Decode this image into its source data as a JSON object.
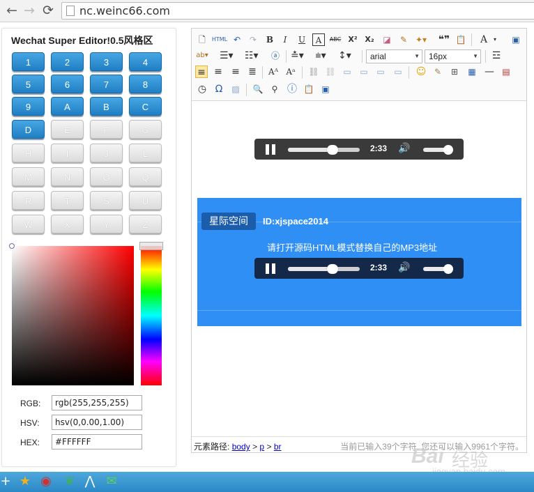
{
  "browser": {
    "back_icon": "←",
    "forward_icon": "→",
    "reload_icon": "⟳",
    "url": "nc.weinc66.com"
  },
  "left_panel": {
    "title": "Wechat Super Editor!0.5风格区",
    "style_buttons": [
      {
        "label": "1",
        "active": true
      },
      {
        "label": "2",
        "active": true
      },
      {
        "label": "3",
        "active": true
      },
      {
        "label": "4",
        "active": true
      },
      {
        "label": "5",
        "active": true
      },
      {
        "label": "6",
        "active": true
      },
      {
        "label": "7",
        "active": true
      },
      {
        "label": "8",
        "active": true
      },
      {
        "label": "9",
        "active": true
      },
      {
        "label": "A",
        "active": true
      },
      {
        "label": "B",
        "active": true
      },
      {
        "label": "C",
        "active": true
      },
      {
        "label": "D",
        "active": true
      },
      {
        "label": "E",
        "active": false
      },
      {
        "label": "F",
        "active": false
      },
      {
        "label": "G",
        "active": false
      },
      {
        "label": "H",
        "active": false
      },
      {
        "label": "I",
        "active": false
      },
      {
        "label": "J",
        "active": false
      },
      {
        "label": "L",
        "active": false
      },
      {
        "label": "M",
        "active": false
      },
      {
        "label": "N",
        "active": false
      },
      {
        "label": "O",
        "active": false
      },
      {
        "label": "Q",
        "active": false
      },
      {
        "label": "R",
        "active": false
      },
      {
        "label": "T",
        "active": false
      },
      {
        "label": "S",
        "active": false
      },
      {
        "label": "U",
        "active": false
      },
      {
        "label": "W",
        "active": false
      },
      {
        "label": "X",
        "active": false
      },
      {
        "label": "Y",
        "active": false
      },
      {
        "label": "Z",
        "active": false
      }
    ],
    "color_picker": {
      "base_hue_color": "#FF0000",
      "rgb_label": "RGB:",
      "rgb_value": "rgb(255,255,255)",
      "hsv_label": "HSV:",
      "hsv_value": "hsv(0,0.00,1.00)",
      "hex_label": "HEX:",
      "hex_value": "#FFFFFF"
    }
  },
  "toolbar": {
    "font_family": "arial",
    "font_size": "16px",
    "row1_icons": [
      "new-doc-icon",
      "html-icon",
      "undo-icon",
      "redo-icon",
      "bold-icon",
      "italic-icon",
      "underline-icon",
      "font-border-icon",
      "strikethrough-icon",
      "superscript-icon",
      "subscript-icon",
      "eraser-icon",
      "format-brush-icon",
      "auto-format-icon",
      "blockquote-icon",
      "paste-text-icon",
      "forecolor-icon",
      "fullscreen-icon"
    ],
    "row1_text": {
      "html": "HTML",
      "bold": "B",
      "italic": "I",
      "underline": "U",
      "fontborder": "A",
      "strike": "ABC",
      "sup": "X²",
      "sub": "X₂",
      "quote": "❝❞",
      "forecolor": "A"
    }
  },
  "editor": {
    "player_top": {
      "time": "2:33",
      "progress": 0.62,
      "volume": 0.85
    },
    "blue_box": {
      "background": "#2F8FF5",
      "tag": "星际空间",
      "id_text": "ID:xjspace2014",
      "message": "请打开源码HTML模式替换自己的MP3地址",
      "player": {
        "time": "2:33",
        "progress": 0.62,
        "volume": 0.85
      }
    },
    "status": {
      "path_label": "元素路径:",
      "path_items": [
        "body",
        "p",
        "br"
      ],
      "separator": ">",
      "count_text": "当前已输入39个字符, 您还可以输入9961个字符。"
    }
  },
  "watermark": {
    "brand": "Bai",
    "cn": "经验",
    "site": "jingyan.baidu.com"
  },
  "taskbar": {
    "icons": [
      "plus-icon",
      "star-icon",
      "weibo-icon",
      "leaf-icon",
      "tencent-icon",
      "wechat-icon"
    ]
  }
}
